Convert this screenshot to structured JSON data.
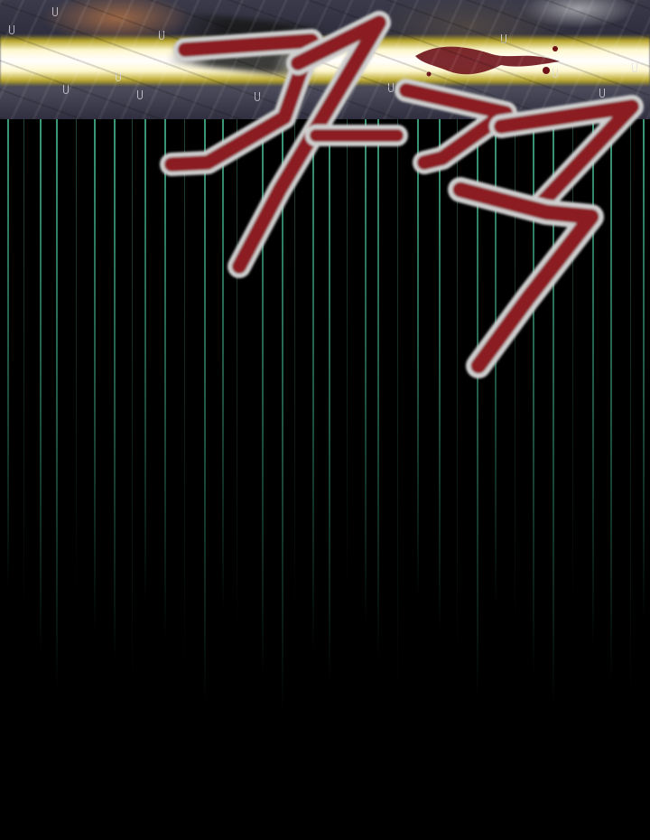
{
  "panel": {
    "sfx_text": "자작",
    "colors": {
      "background": "#000000",
      "streak": "#46b48c",
      "beam": "#fff8d0",
      "sfx_fill": "#8b1a22",
      "sfx_outline": "#d8d8d8"
    }
  }
}
